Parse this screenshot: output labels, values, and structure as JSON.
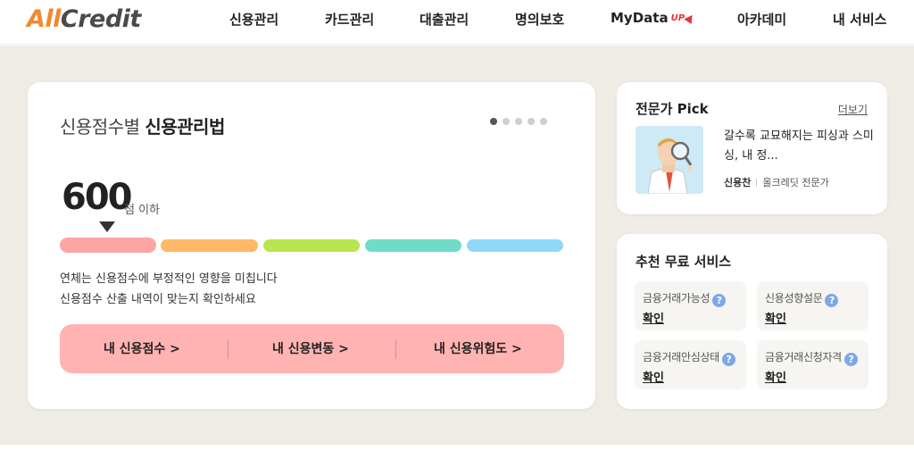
{
  "header": {
    "logo_part1": "All",
    "logo_part2": "Credit",
    "nav": [
      "신용관리",
      "카드관리",
      "대출관리",
      "명의보호",
      "MyData",
      "아카데미",
      "내 서비스"
    ],
    "mydata_badge": "UP"
  },
  "main": {
    "title_light": "신용점수별 ",
    "title_bold": "신용관리법",
    "slides_total": 5,
    "slide_active": 1,
    "score": "600",
    "score_unit": "점 이하",
    "band_colors": [
      "#ffa4a4",
      "#ffb866",
      "#b8e550",
      "#6fdcc8",
      "#8fd8f8"
    ],
    "desc_line1": "연체는 신용점수에 부정적인 영향을 미칩니다",
    "desc_line2": "신용점수 산출 내역이 맞는지 확인하세요",
    "buttons": [
      "내 신용점수 >",
      "내 신용변동 >",
      "내 신용위험도 >"
    ]
  },
  "pick": {
    "title": "전문가 Pick",
    "more": "더보기",
    "article_title": "갈수록 교묘해지는 피싱과 스미싱, 내 정...",
    "author": "신용찬",
    "author_org": "올크레딧 전문가"
  },
  "services": {
    "title": "추천 무료 서비스",
    "items": [
      {
        "label": "금융거래가능성",
        "action": "확인"
      },
      {
        "label": "신용성향설문",
        "action": "확인"
      },
      {
        "label": "금융거래안심상태",
        "action": "확인"
      },
      {
        "label": "금융거래신청자격",
        "action": "확인"
      }
    ]
  },
  "colors": {
    "accent_orange": "#f08a2e",
    "button_pink": "#ffb3b2",
    "background": "#efece5"
  }
}
